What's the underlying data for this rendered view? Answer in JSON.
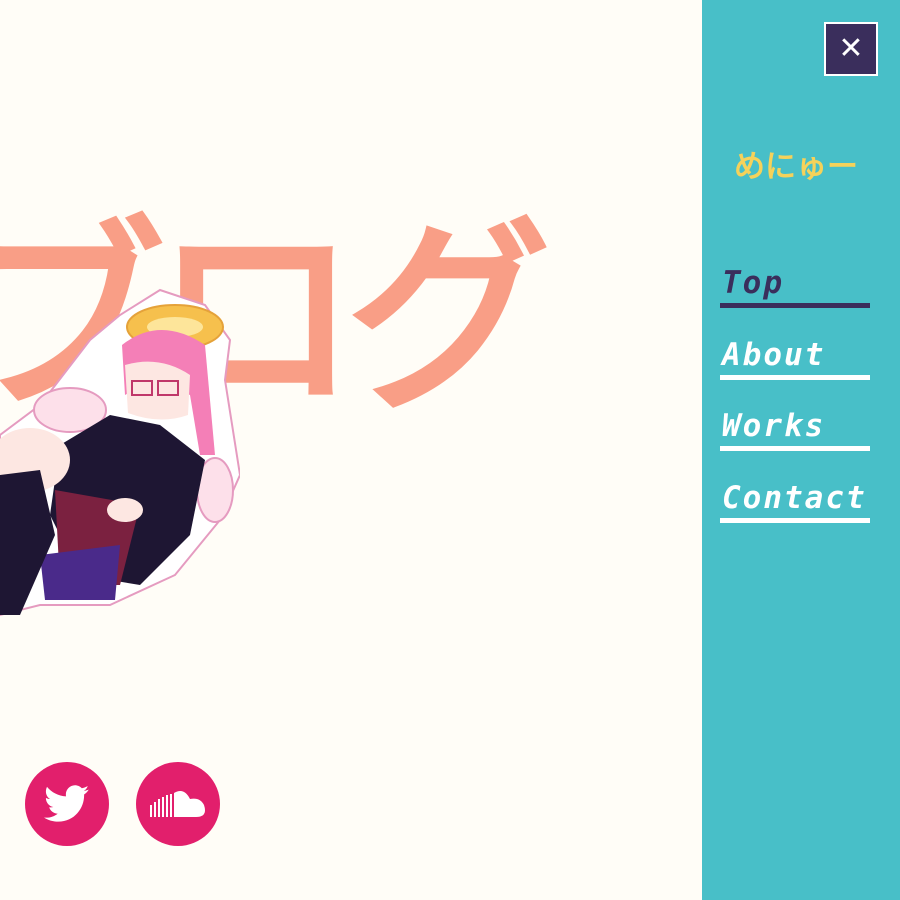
{
  "hero": {
    "title": "ブログ"
  },
  "social": {
    "twitter_icon": "twitter-bird-icon",
    "soundcloud_icon": "soundcloud-icon",
    "button_color": "#e21f6c"
  },
  "menu": {
    "title": "めにゅー",
    "close_icon": "close-icon",
    "items": [
      {
        "label": "Top",
        "active": true
      },
      {
        "label": "About",
        "active": false
      },
      {
        "label": "Works",
        "active": false
      },
      {
        "label": "Contact",
        "active": false
      }
    ],
    "panel_color": "#48bfc8",
    "accent_color": "#3a2e5c",
    "title_color": "#f5d25a"
  }
}
